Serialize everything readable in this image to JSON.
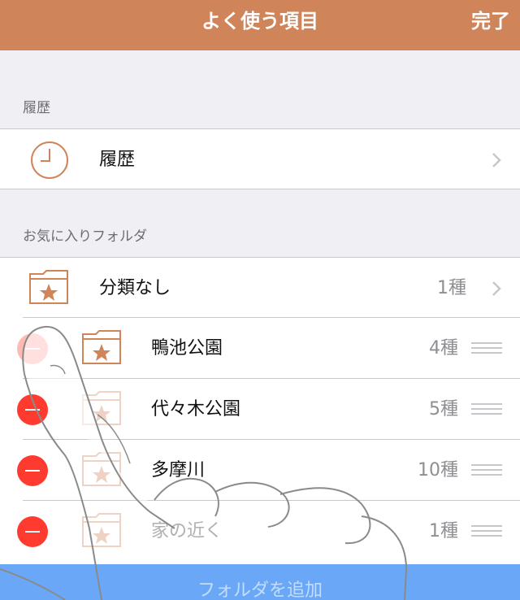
{
  "navbar": {
    "title": "よく使う項目",
    "done_label": "完了"
  },
  "history_section": {
    "header": "履歴",
    "row": {
      "label": "履歴",
      "icon": "clock-icon"
    }
  },
  "favorites_section": {
    "header": "お気に入りフォルダ",
    "unclassified": {
      "label": "分類なし",
      "count": "1種",
      "icon": "star-folder-icon"
    },
    "folders": [
      {
        "label": "鴨池公園",
        "count": "4種"
      },
      {
        "label": "代々木公園",
        "count": "5種"
      },
      {
        "label": "多摩川",
        "count": "10種"
      },
      {
        "label": "家の近く",
        "count": "1種"
      }
    ]
  },
  "add_button": {
    "label": "フォルダを追加"
  },
  "colors": {
    "accent": "#d0845a",
    "delete": "#ff3b30",
    "add_bar": "#6aa8f7"
  }
}
